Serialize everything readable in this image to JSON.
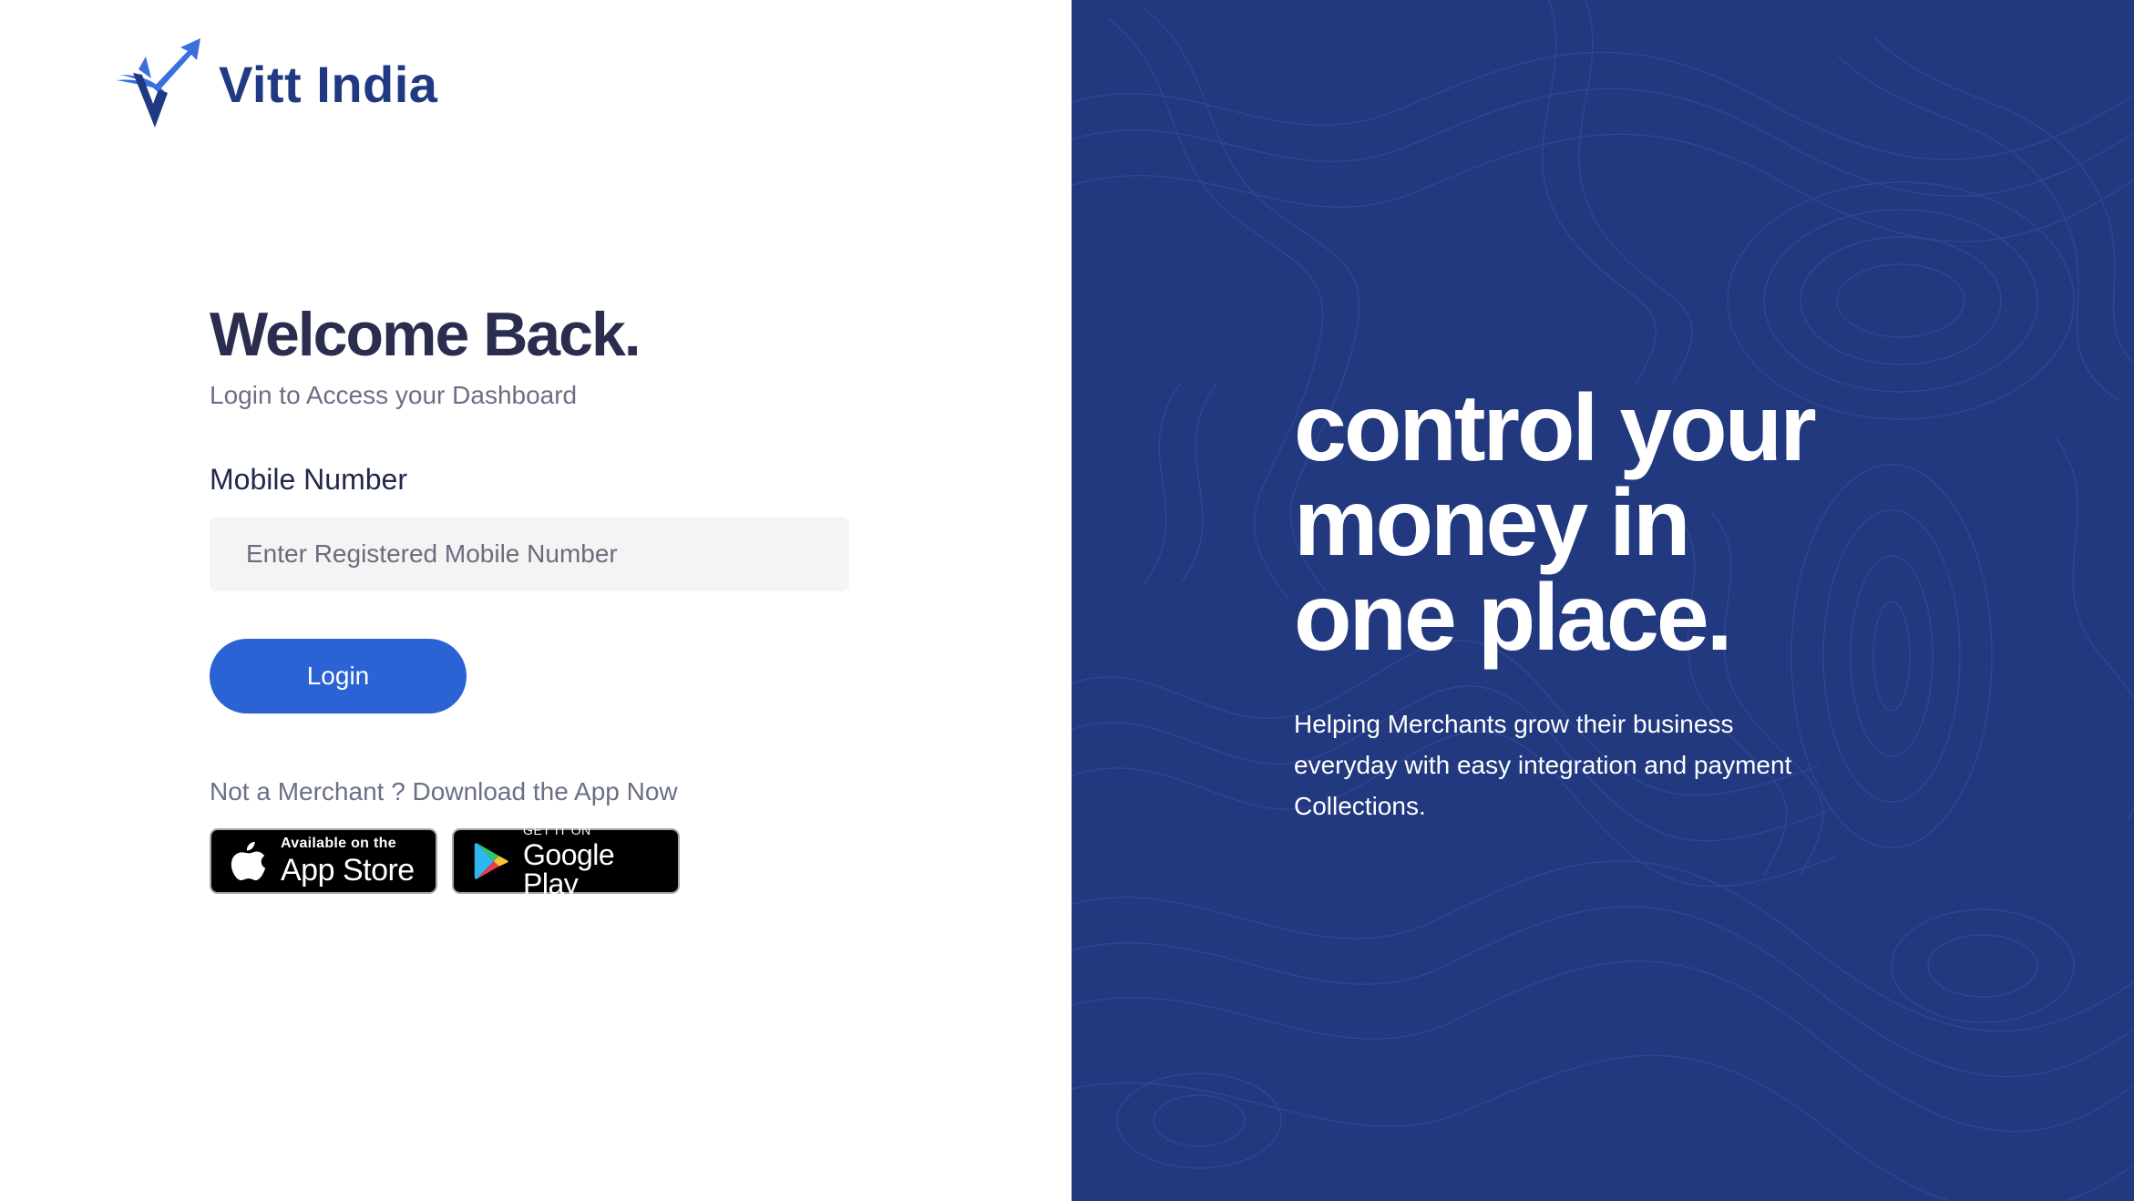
{
  "brand": {
    "name": "Vitt India",
    "logo_icon": "vitt-india-logo-icon"
  },
  "login": {
    "title": "Welcome Back.",
    "subtitle": "Login to Access your Dashboard",
    "mobile_label": "Mobile Number",
    "mobile_placeholder": "Enter Registered Mobile Number",
    "mobile_value": "",
    "login_button": "Login",
    "download_prompt": "Not a Merchant ? Download the App Now"
  },
  "stores": {
    "apple": {
      "icon": "apple-icon",
      "small": "Available on the",
      "big": "App Store"
    },
    "google": {
      "icon": "google-play-icon",
      "small": "GET IT ON",
      "big": "Google Play"
    }
  },
  "hero": {
    "line1": "control your",
    "line2": "money in",
    "line3": "one place.",
    "description": "Helping Merchants grow their business everyday with easy integration and payment Collections."
  },
  "colors": {
    "brand_blue": "#1f3a82",
    "button_blue": "#2b62d4",
    "panel_blue": "#22397f",
    "heading": "#2b2d4f",
    "muted": "#6b6f86"
  }
}
